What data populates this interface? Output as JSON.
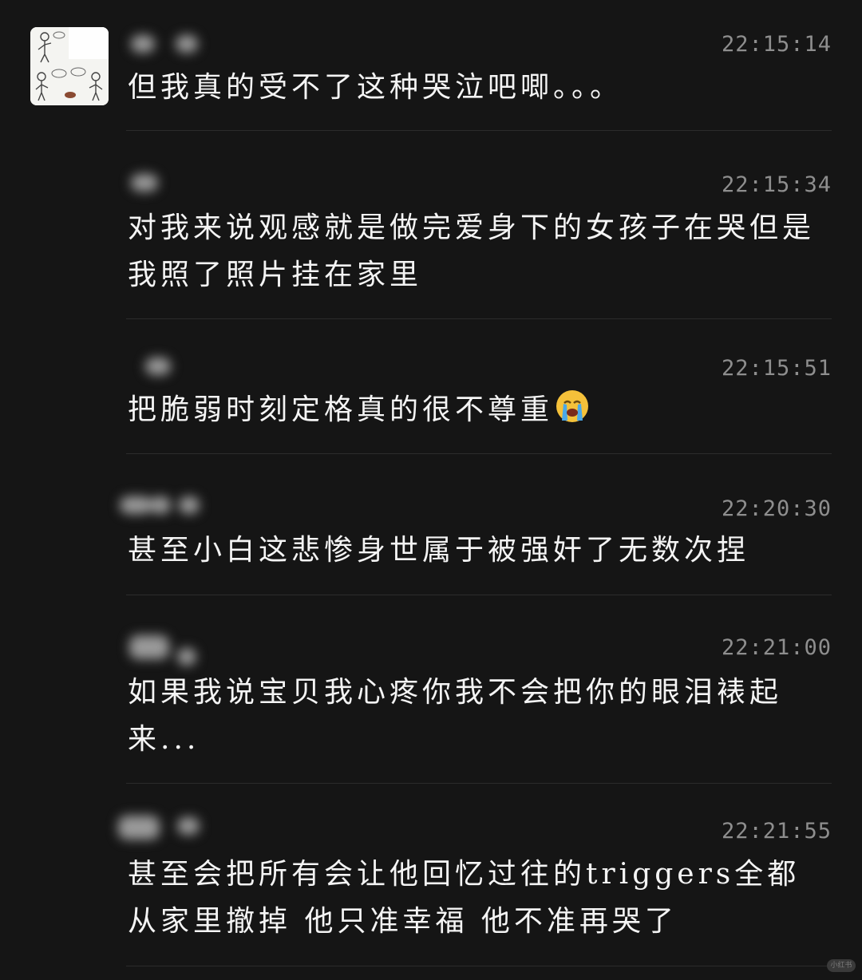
{
  "chat": {
    "avatar_icon": "comic-avatar-icon",
    "messages": [
      {
        "time": "22:15:14",
        "text": "但我真的受不了这种哭泣吧唧。。。"
      },
      {
        "time": "22:15:34",
        "text": "对我来说观感就是做完爱身下的女孩子在哭但是我照了照片挂在家里"
      },
      {
        "time": "22:15:51",
        "text": "把脆弱时刻定格真的很不尊重",
        "emoji": "loudly-crying-face-icon"
      },
      {
        "time": "22:20:30",
        "text": "甚至小白这悲惨身世属于被强奸了无数次捏"
      },
      {
        "time": "22:21:00",
        "text": "如果我说宝贝我心疼你我不会把你的眼泪裱起来..."
      },
      {
        "time": "22:21:55",
        "text": "甚至会把所有会让他回忆过往的triggers全都从家里撤掉 他只准幸福 他不准再哭了"
      }
    ]
  },
  "watermark": {
    "text": "小红书"
  },
  "colors": {
    "background": "#151515",
    "text": "#f4f4f4",
    "timestamp": "#8e8e8e",
    "divider": "#2c2c2c"
  }
}
